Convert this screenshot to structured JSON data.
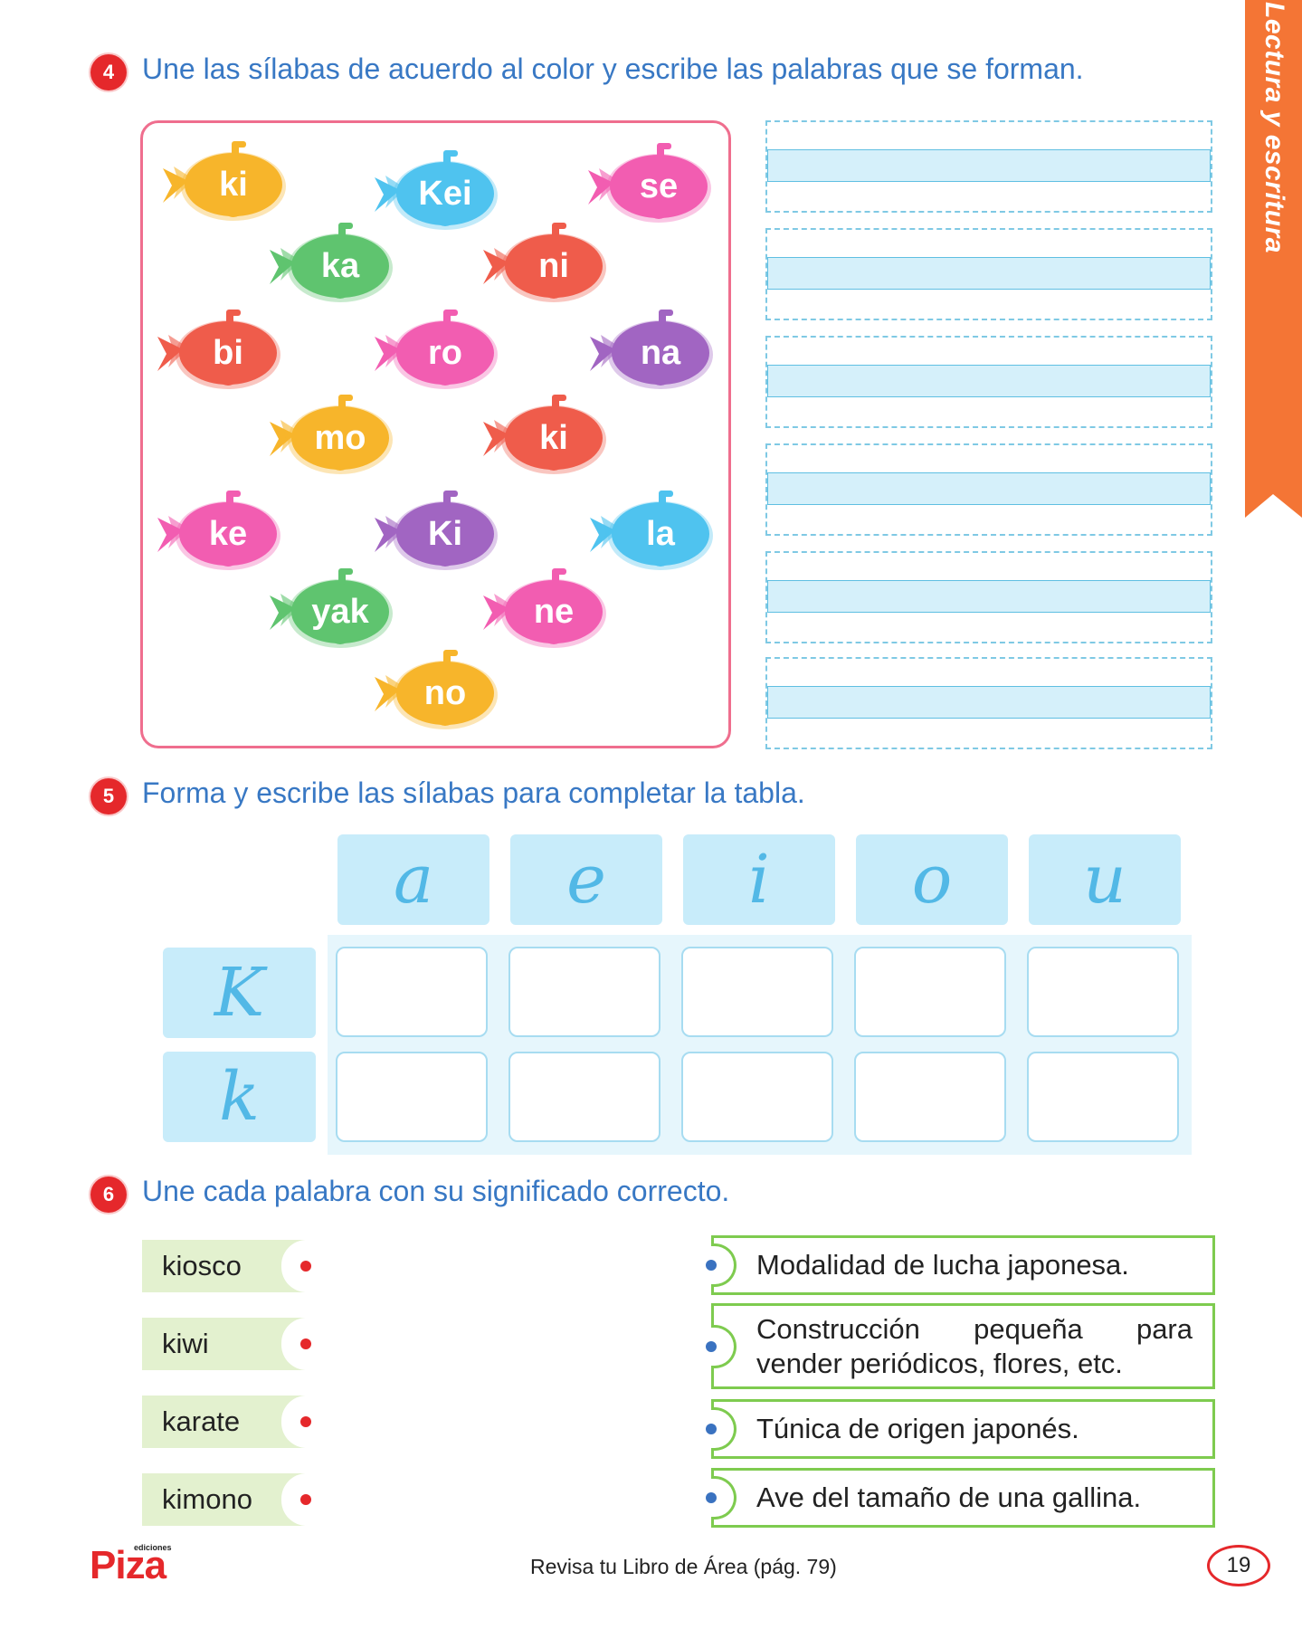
{
  "side_tab": {
    "label": "Lectura y escritura",
    "color": "#f47535"
  },
  "exercise4": {
    "number": "4",
    "instruction": "Une las sílabas de acuerdo al color y escribe las palabras que se forman.",
    "fish": [
      {
        "syllable": "ki",
        "color": "#f7b52b"
      },
      {
        "syllable": "Kei",
        "color": "#4fc3ef"
      },
      {
        "syllable": "se",
        "color": "#f25db1"
      },
      {
        "syllable": "ka",
        "color": "#5fc46f"
      },
      {
        "syllable": "ni",
        "color": "#ef5c4b"
      },
      {
        "syllable": "bi",
        "color": "#ef5c4b"
      },
      {
        "syllable": "ro",
        "color": "#f25db1"
      },
      {
        "syllable": "na",
        "color": "#a165c2"
      },
      {
        "syllable": "mo",
        "color": "#f7b52b"
      },
      {
        "syllable": "ki",
        "color": "#ef5c4b"
      },
      {
        "syllable": "ke",
        "color": "#f25db1"
      },
      {
        "syllable": "Ki",
        "color": "#a165c2"
      },
      {
        "syllable": "la",
        "color": "#4fc3ef"
      },
      {
        "syllable": "yak",
        "color": "#5fc46f"
      },
      {
        "syllable": "ne",
        "color": "#f25db1"
      },
      {
        "syllable": "no",
        "color": "#f7b52b"
      }
    ],
    "writing_lines": 6
  },
  "exercise5": {
    "number": "5",
    "instruction": "Forma y escribe las sílabas para completar la tabla.",
    "vowels": [
      "a",
      "e",
      "i",
      "o",
      "u"
    ],
    "consonants": [
      "K",
      "k"
    ]
  },
  "exercise6": {
    "number": "6",
    "instruction": "Une cada palabra con su significado correcto.",
    "words": [
      "kiosco",
      "kiwi",
      "karate",
      "kimono"
    ],
    "definitions": [
      "Modalidad de lucha japonesa.",
      "Construcción pequeña para vender periódicos, flores, etc.",
      "Túnica de origen japonés.",
      "Ave del tamaño de una gallina."
    ]
  },
  "footer": {
    "logo": "Piza",
    "logo_small": "ediciones",
    "review_text": "Revisa tu Libro de Área (pág. 79)",
    "page_number": "19"
  }
}
